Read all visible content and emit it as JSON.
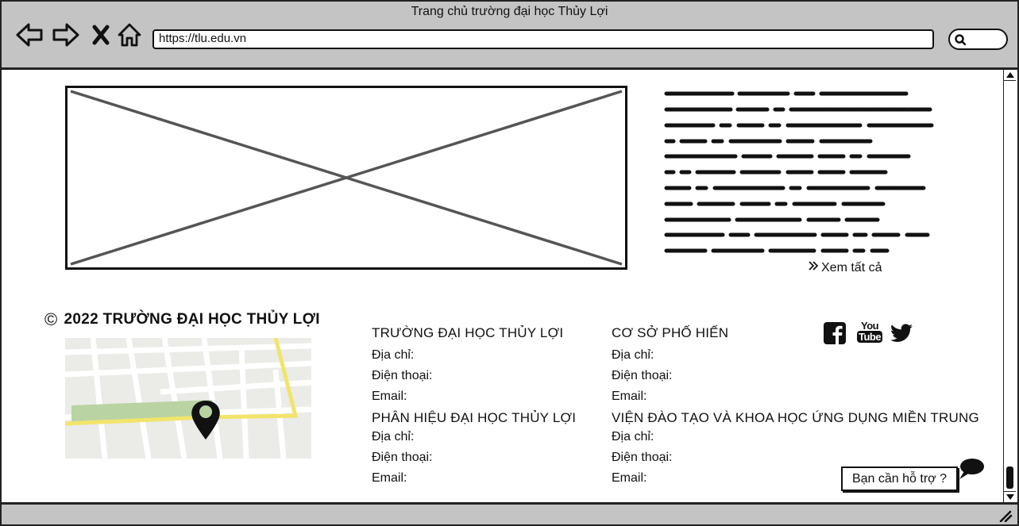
{
  "window": {
    "title": "Trang chủ trường đại học Thủy Lợi"
  },
  "nav": {
    "back_icon": "arrow-left-icon",
    "forward_icon": "arrow-right-icon",
    "close_icon": "x-icon",
    "home_icon": "home-icon"
  },
  "address_bar": {
    "url": "https://tlu.edu.vn"
  },
  "search": {
    "icon": "search-icon"
  },
  "main": {
    "see_all_label": "Xem tất cả"
  },
  "footer": {
    "copyright": "2022 TRƯỜNG ĐẠI HỌC THỦY LỢI",
    "columns": [
      {
        "title": "TRƯỜNG ĐẠI HỌC THỦY LỢI",
        "address": "Địa chỉ:",
        "phone": "Điện thoại:",
        "email": "Email:"
      },
      {
        "title": "CƠ SỞ PHỐ HIẾN",
        "address": "Địa chỉ:",
        "phone": "Điện thoại:",
        "email": "Email:"
      },
      {
        "title": "PHÂN HIỆU ĐẠI HỌC THỦY LỢI",
        "address": "Địa chỉ:",
        "phone": "Điện thoại:",
        "email": "Email:"
      },
      {
        "title": "VIỆN ĐÀO TẠO VÀ KHOA HỌC ỨNG DỤNG MIỀN TRUNG",
        "address": "Địa chỉ:",
        "phone": "Điện thoại:",
        "email": "Email:"
      }
    ],
    "social": [
      "facebook-icon",
      "youtube-icon",
      "twitter-icon"
    ],
    "youtube_text_top": "You",
    "youtube_text_bottom": "Tube"
  },
  "support": {
    "label": "Bạn cần hỗ trợ ?"
  },
  "colors": {
    "chrome": "#c4c4c4",
    "map_road": "#f2e46b",
    "map_park": "#b9d3a3",
    "map_bg": "#ebebe8"
  }
}
